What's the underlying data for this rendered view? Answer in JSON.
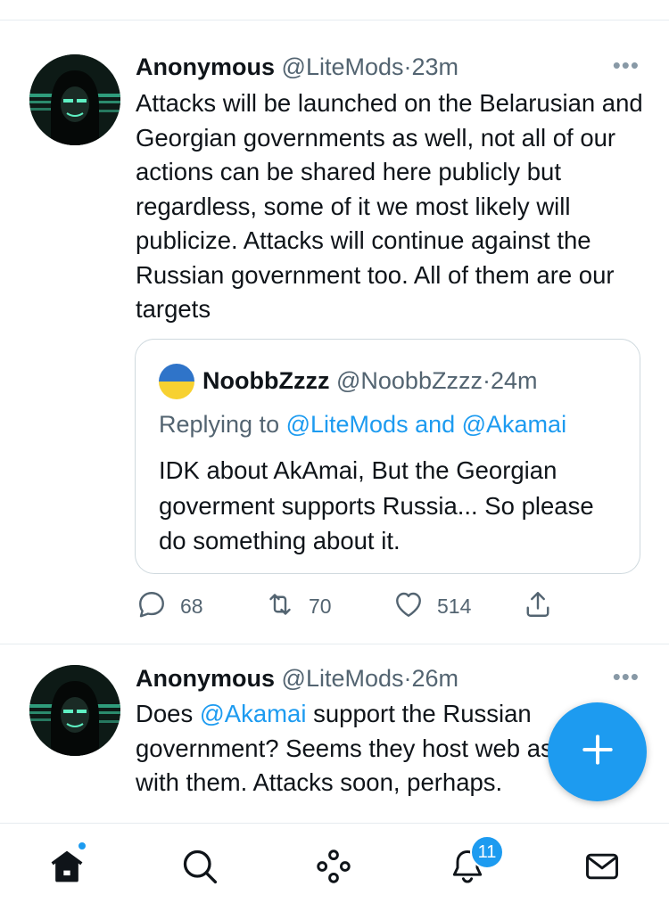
{
  "tweets": [
    {
      "name": "Anonymous",
      "handle": "@LiteMods",
      "separator": "·",
      "time": "23m",
      "more": "•••",
      "text": "Attacks will be launched on the Belarusian and Georgian governments as well, not all of our actions can be shared here publicly but regardless, some of it we most likely will publicize. Attacks will continue against the Russian government too. All of them are our targets",
      "quote": {
        "name": "NoobbZzzz",
        "handle": "@NoobbZzzz",
        "separator": "·",
        "time": "24m",
        "replying_prefix": "Replying to",
        "replying_users": "@LiteMods and @Akamai",
        "text": "IDK about AkAmai, But the Georgian goverment supports Russia... So please do something about it."
      },
      "actions": {
        "replies": "68",
        "retweets": "70",
        "likes": "514"
      }
    },
    {
      "name": "Anonymous",
      "handle": "@LiteMods",
      "separator": "·",
      "time": "26m",
      "more": "•••",
      "text_prefix": "Does",
      "text_mention": "@Akamai",
      "text_suffix": "support the Russian government? Seems they host web associated with them. Attacks soon, perhaps."
    }
  ],
  "bottom_nav": {
    "notifications_badge": "11"
  },
  "colors": {
    "accent": "#1d9bf0",
    "secondary_text": "#536471",
    "divider": "#e6ecf0"
  },
  "icons": [
    "home-icon",
    "search-icon",
    "spaces-icon",
    "notifications-icon",
    "messages-icon",
    "reply-icon",
    "retweet-icon",
    "like-icon",
    "share-icon",
    "compose-icon"
  ]
}
